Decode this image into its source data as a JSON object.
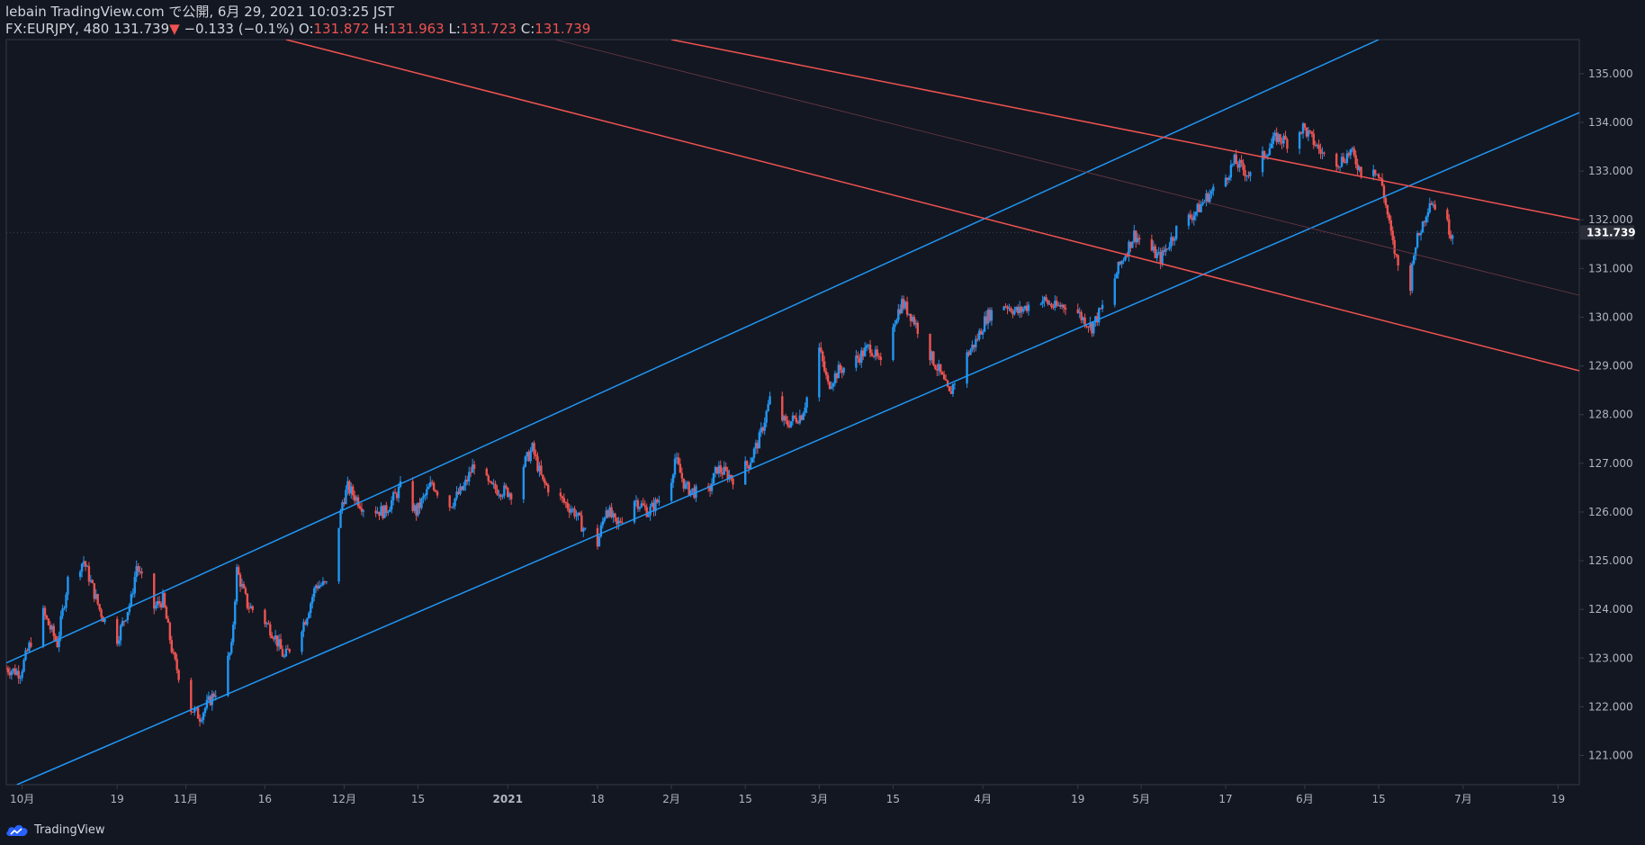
{
  "header": {
    "line1": "lebain TradingView.com で公開, 6月 29, 2021 10:03:25 JST",
    "symbol": "FX:EURJPY, 480",
    "last": "131.739",
    "arrow": "▼",
    "change": "−0.133 (−0.1%)",
    "o_label": "O:",
    "o_val": "131.872",
    "h_label": "H:",
    "h_val": "131.963",
    "l_label": "L:",
    "l_val": "131.723",
    "c_label": "C:",
    "c_val": "131.739"
  },
  "footer": {
    "brand": "TradingView",
    "logo_icon": "tradingview-cloud-icon"
  },
  "colors": {
    "background": "#131722",
    "up": "#2962ff",
    "up_line": "#2196f3",
    "down": "#ef5350",
    "axis_text": "#b2b5be",
    "axis_line": "#363a45"
  },
  "chart_data": {
    "type": "candlestick",
    "title": "",
    "ylim": [
      120.4,
      135.7
    ],
    "yticks": [
      121.0,
      122.0,
      123.0,
      124.0,
      125.0,
      126.0,
      127.0,
      128.0,
      129.0,
      130.0,
      131.0,
      132.0,
      133.0,
      134.0,
      135.0
    ],
    "ytick_labels": [
      "121.000",
      "122.000",
      "123.000",
      "124.000",
      "125.000",
      "126.000",
      "127.000",
      "128.000",
      "129.000",
      "130.000",
      "131.000",
      "132.000",
      "133.000",
      "134.000",
      "135.000"
    ],
    "last_price": 131.739,
    "last_price_label": "131.739",
    "x_range": [
      "2020-09-28",
      "2021-07-23"
    ],
    "xticks": [
      {
        "date": "2020-10-01",
        "label": "10月",
        "bold": false
      },
      {
        "date": "2020-10-19",
        "label": "19",
        "bold": false
      },
      {
        "date": "2020-11-01",
        "label": "11月",
        "bold": false
      },
      {
        "date": "2020-11-16",
        "label": "16",
        "bold": false
      },
      {
        "date": "2020-12-01",
        "label": "12月",
        "bold": false
      },
      {
        "date": "2020-12-15",
        "label": "15",
        "bold": false
      },
      {
        "date": "2021-01-01",
        "label": "2021",
        "bold": true
      },
      {
        "date": "2021-01-18",
        "label": "18",
        "bold": false
      },
      {
        "date": "2021-02-01",
        "label": "2月",
        "bold": false
      },
      {
        "date": "2021-02-15",
        "label": "15",
        "bold": false
      },
      {
        "date": "2021-03-01",
        "label": "3月",
        "bold": false
      },
      {
        "date": "2021-03-15",
        "label": "15",
        "bold": false
      },
      {
        "date": "2021-04-01",
        "label": "4月",
        "bold": false
      },
      {
        "date": "2021-04-19",
        "label": "19",
        "bold": false
      },
      {
        "date": "2021-05-01",
        "label": "5月",
        "bold": false
      },
      {
        "date": "2021-05-17",
        "label": "17",
        "bold": false
      },
      {
        "date": "2021-06-01",
        "label": "6月",
        "bold": false
      },
      {
        "date": "2021-06-15",
        "label": "15",
        "bold": false
      },
      {
        "date": "2021-07-01",
        "label": "7月",
        "bold": false
      },
      {
        "date": "2021-07-19",
        "label": "19",
        "bold": false
      }
    ],
    "price_path": [
      [
        "2020-09-28",
        122.8
      ],
      [
        "2020-10-01",
        122.7
      ],
      [
        "2020-10-05",
        124.0
      ],
      [
        "2020-10-08",
        123.3
      ],
      [
        "2020-10-10",
        124.6
      ],
      [
        "2020-10-13",
        125.0
      ],
      [
        "2020-10-16",
        124.0
      ],
      [
        "2020-10-19",
        123.3
      ],
      [
        "2020-10-22",
        124.2
      ],
      [
        "2020-10-23",
        124.9
      ],
      [
        "2020-10-26",
        124.0
      ],
      [
        "2020-10-28",
        124.2
      ],
      [
        "2020-10-30",
        123.0
      ],
      [
        "2020-11-02",
        122.0
      ],
      [
        "2020-11-04",
        121.8
      ],
      [
        "2020-11-08",
        122.5
      ],
      [
        "2020-11-10",
        123.2
      ],
      [
        "2020-11-11",
        124.8
      ],
      [
        "2020-11-13",
        124.1
      ],
      [
        "2020-11-16",
        123.8
      ],
      [
        "2020-11-18",
        123.5
      ],
      [
        "2020-11-20",
        123.0
      ],
      [
        "2020-11-24",
        123.8
      ],
      [
        "2020-11-26",
        124.5
      ],
      [
        "2020-11-28",
        124.5
      ],
      [
        "2020-11-30",
        125.5
      ],
      [
        "2020-12-01",
        126.2
      ],
      [
        "2020-12-02",
        126.5
      ],
      [
        "2020-12-05",
        126.1
      ],
      [
        "2020-12-09",
        126.0
      ],
      [
        "2020-12-12",
        126.5
      ],
      [
        "2020-12-15",
        126.0
      ],
      [
        "2020-12-18",
        126.6
      ],
      [
        "2020-12-21",
        126.1
      ],
      [
        "2020-12-24",
        126.5
      ],
      [
        "2020-12-26",
        127.0
      ],
      [
        "2020-12-29",
        126.5
      ],
      [
        "2021-01-02",
        126.4
      ],
      [
        "2021-01-04",
        126.9
      ],
      [
        "2021-01-06",
        127.3
      ],
      [
        "2021-01-08",
        126.6
      ],
      [
        "2021-01-11",
        126.3
      ],
      [
        "2021-01-14",
        126.0
      ],
      [
        "2021-01-18",
        125.2
      ],
      [
        "2021-01-20",
        126.1
      ],
      [
        "2021-01-22",
        125.7
      ],
      [
        "2021-01-25",
        126.3
      ],
      [
        "2021-01-28",
        126.0
      ],
      [
        "2021-02-01",
        126.5
      ],
      [
        "2021-02-02",
        127.1
      ],
      [
        "2021-02-04",
        126.5
      ],
      [
        "2021-02-08",
        126.3
      ],
      [
        "2021-02-10",
        126.9
      ],
      [
        "2021-02-13",
        126.7
      ],
      [
        "2021-02-16",
        127.0
      ],
      [
        "2021-02-18",
        127.5
      ],
      [
        "2021-02-20",
        128.3
      ],
      [
        "2021-02-23",
        127.8
      ],
      [
        "2021-02-26",
        128.0
      ],
      [
        "2021-02-28",
        128.7
      ],
      [
        "2021-03-01",
        129.5
      ],
      [
        "2021-03-03",
        128.6
      ],
      [
        "2021-03-05",
        128.9
      ],
      [
        "2021-03-08",
        129.1
      ],
      [
        "2021-03-11",
        129.4
      ],
      [
        "2021-03-13",
        129.0
      ],
      [
        "2021-03-15",
        129.8
      ],
      [
        "2021-03-17",
        130.3
      ],
      [
        "2021-03-19",
        130.0
      ],
      [
        "2021-03-22",
        129.3
      ],
      [
        "2021-03-24",
        128.9
      ],
      [
        "2021-03-26",
        128.4
      ],
      [
        "2021-03-28",
        129.0
      ],
      [
        "2021-03-31",
        129.5
      ],
      [
        "2021-04-02",
        130.0
      ],
      [
        "2021-04-05",
        130.3
      ],
      [
        "2021-04-08",
        130.1
      ],
      [
        "2021-04-12",
        130.4
      ],
      [
        "2021-04-15",
        130.2
      ],
      [
        "2021-04-18",
        130.3
      ],
      [
        "2021-04-20",
        130.0
      ],
      [
        "2021-04-22",
        129.8
      ],
      [
        "2021-04-25",
        130.4
      ],
      [
        "2021-04-27",
        131.0
      ],
      [
        "2021-04-30",
        131.7
      ],
      [
        "2021-05-03",
        131.4
      ],
      [
        "2021-05-05",
        131.2
      ],
      [
        "2021-05-08",
        131.8
      ],
      [
        "2021-05-10",
        132.0
      ],
      [
        "2021-05-12",
        132.2
      ],
      [
        "2021-05-14",
        132.5
      ],
      [
        "2021-05-17",
        132.8
      ],
      [
        "2021-05-19",
        133.2
      ],
      [
        "2021-05-22",
        132.9
      ],
      [
        "2021-05-25",
        133.4
      ],
      [
        "2021-05-27",
        133.7
      ],
      [
        "2021-05-29",
        133.6
      ],
      [
        "2021-06-01",
        133.9
      ],
      [
        "2021-06-03",
        133.6
      ],
      [
        "2021-06-05",
        133.3
      ],
      [
        "2021-06-08",
        133.2
      ],
      [
        "2021-06-10",
        133.4
      ],
      [
        "2021-06-12",
        133.0
      ],
      [
        "2021-06-14",
        133.2
      ],
      [
        "2021-06-16",
        132.7
      ],
      [
        "2021-06-18",
        131.5
      ],
      [
        "2021-06-20",
        130.6
      ],
      [
        "2021-06-21",
        130.3
      ],
      [
        "2021-06-22",
        131.4
      ],
      [
        "2021-06-23",
        131.7
      ],
      [
        "2021-06-25",
        132.4
      ],
      [
        "2021-06-27",
        132.2
      ],
      [
        "2021-06-29",
        131.74
      ]
    ],
    "trendlines": [
      {
        "name": "ascending-channel-upper",
        "color": "#2196f3",
        "width": 1.5,
        "p1": [
          "2020-09-28",
          122.9
        ],
        "p2": [
          "2021-06-15",
          135.7
        ]
      },
      {
        "name": "ascending-channel-lower",
        "color": "#2196f3",
        "width": 1.5,
        "p1": [
          "2020-09-30",
          120.4
        ],
        "p2": [
          "2021-07-23",
          134.2
        ]
      },
      {
        "name": "descending-channel-upper",
        "color": "#ef5350",
        "width": 1.5,
        "p1": [
          "2021-02-01",
          135.7
        ],
        "p2": [
          "2021-07-23",
          132.0
        ]
      },
      {
        "name": "descending-channel-lower",
        "color": "#ef5350",
        "width": 1.5,
        "p1": [
          "2020-11-20",
          135.7
        ],
        "p2": [
          "2021-07-23",
          128.9
        ]
      },
      {
        "name": "descending-channel-mid",
        "color": "#6b3a45",
        "width": 0.8,
        "p1": [
          "2021-01-10",
          135.7
        ],
        "p2": [
          "2021-07-23",
          130.45
        ]
      }
    ]
  }
}
